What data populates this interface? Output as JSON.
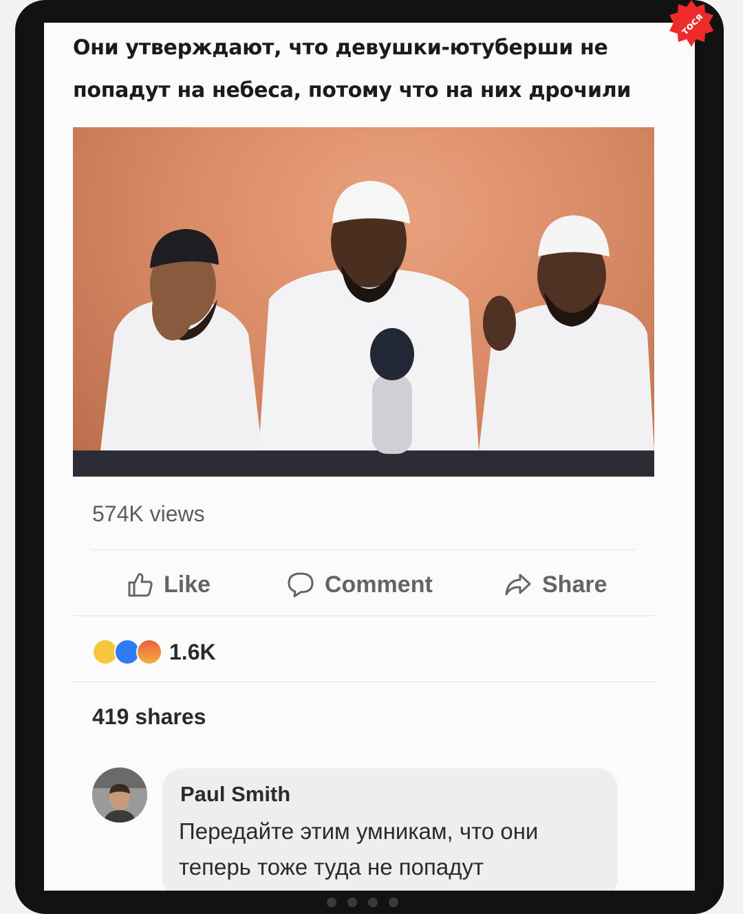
{
  "post": {
    "headline": "Они утверждают, что девушки-ютуберши не попадут на небеса, потому что на них дрочили",
    "views": "574K views"
  },
  "actions": {
    "like": "Like",
    "comment": "Comment",
    "share": "Share"
  },
  "reactions": {
    "count": "1.6K",
    "icons": [
      "haha-icon",
      "like-icon",
      "angry-icon"
    ]
  },
  "shares": "419 shares",
  "comment": {
    "author": "Paul Smith",
    "text": "Передайте этим умникам, что они теперь тоже туда не попадут"
  },
  "sticker": {
    "label": "тося",
    "color": "#ee2a2a"
  },
  "colors": {
    "like_reaction": "#2d7cf6",
    "haha_reaction": "#f7c63d",
    "angry_reaction": "#e9603d"
  }
}
